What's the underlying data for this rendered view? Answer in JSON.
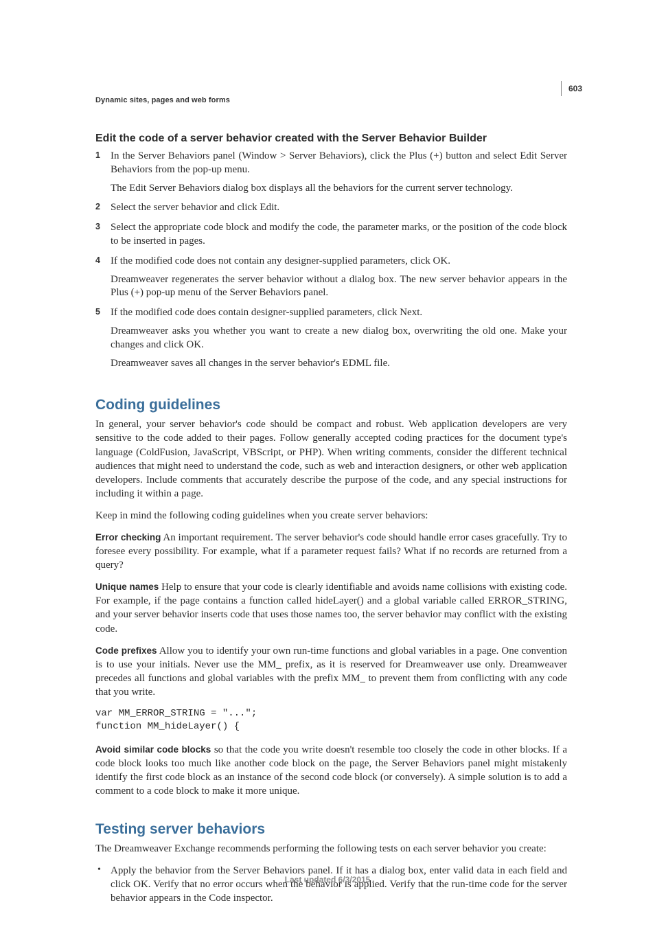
{
  "page_number": "603",
  "breadcrumb": "Dynamic sites, pages and web forms",
  "h_edit": "Edit the code of a server behavior created with the Server Behavior Builder",
  "steps": {
    "s1a": "In the Server Behaviors panel (Window > Server Behaviors), click the Plus (+) button and select Edit Server Behaviors from the pop-up menu.",
    "s1b": "The Edit Server Behaviors dialog box displays all the behaviors for the current server technology.",
    "s2": "Select the server behavior and click Edit.",
    "s3": "Select the appropriate code block and modify the code, the parameter marks, or the position of the code block to be inserted in pages.",
    "s4a": "If the modified code does not contain any designer-supplied parameters, click OK.",
    "s4b": "Dreamweaver regenerates the server behavior without a dialog box. The new server behavior appears in the Plus (+) pop-up menu of the Server Behaviors panel.",
    "s5a": "If the modified code does contain designer-supplied parameters, click Next.",
    "s5b": "Dreamweaver asks you whether you want to create a new dialog box, overwriting the old one. Make your changes and click OK.",
    "s5c": "Dreamweaver saves all changes in the server behavior's EDML file."
  },
  "h_coding": "Coding guidelines",
  "coding_intro": "In general, your server behavior's code should be compact and robust. Web application developers are very sensitive to the code added to their pages. Follow generally accepted coding practices for the document type's language (ColdFusion, JavaScript, VBScript, or PHP). When writing comments, consider the different technical audiences that might need to understand the code, such as web and interaction designers, or other web application developers. Include comments that accurately describe the purpose of the code, and any special instructions for including it within a page.",
  "coding_keep": "Keep in mind the following coding guidelines when you create server behaviors:",
  "err_label": "Error checking",
  "err_body": "   An important requirement. The server behavior's code should handle error cases gracefully. Try to foresee every possibility. For example, what if a parameter request fails? What if no records are returned from a query?",
  "uniq_label": "Unique names",
  "uniq_body": "   Help to ensure that your code is clearly identifiable and avoids name collisions with existing code. For example, if the page contains a function called hideLayer() and a global variable called ERROR_STRING, and your server behavior inserts code that uses those names too, the server behavior may conflict with the existing code.",
  "pref_label": "Code prefixes",
  "pref_body": "   Allow you to identify your own run-time functions and global variables in a page. One convention is to use your initials. Never use the MM_ prefix, as it is reserved for Dreamweaver use only. Dreamweaver precedes all functions and global variables with the prefix MM_ to prevent them from conflicting with any code that you write.",
  "code_block": "var MM_ERROR_STRING = \"...\"; \nfunction MM_hideLayer() {",
  "avoid_label": "Avoid similar code blocks",
  "avoid_body": "   so that the code you write doesn't resemble too closely the code in other blocks. If a code block looks too much like another code block on the page, the Server Behaviors panel might mistakenly identify the first code block as an instance of the second code block (or conversely). A simple solution is to add a comment to a code block to make it more unique.",
  "h_testing": "Testing server behaviors",
  "testing_intro": "The Dreamweaver Exchange recommends performing the following tests on each server behavior you create:",
  "bullet1": "Apply the behavior from the Server Behaviors panel. If it has a dialog box, enter valid data in each field and click OK. Verify that no error occurs when the behavior is applied. Verify that the run-time code for the server behavior appears in the Code inspector.",
  "footer": "Last updated 6/3/2015"
}
